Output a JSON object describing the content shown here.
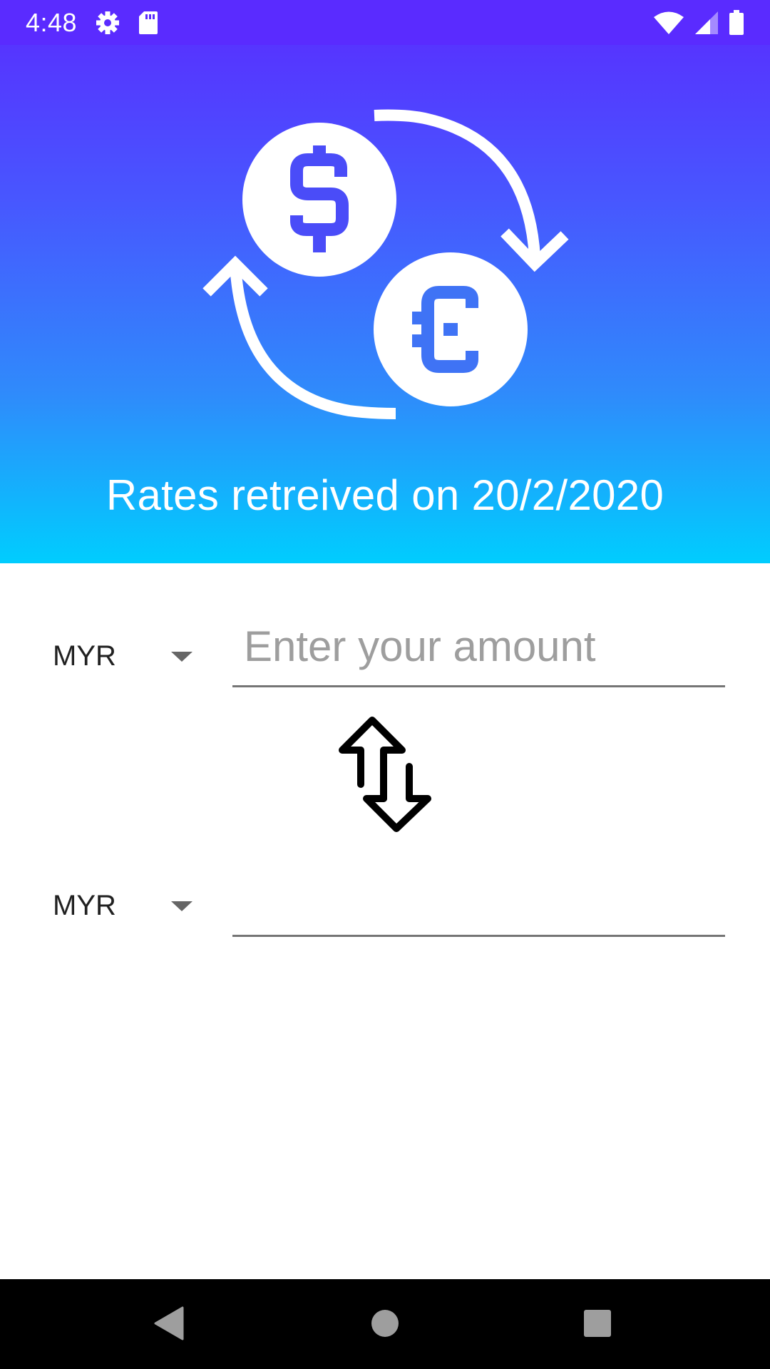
{
  "status_bar": {
    "time": "4:48",
    "icons": [
      "settings-icon",
      "sd-card-icon",
      "wifi-icon",
      "cell-signal-icon",
      "battery-icon"
    ]
  },
  "header": {
    "illustration": "currency-exchange-icon",
    "rates_text": "Rates retreived on 20/2/2020",
    "gradient": [
      "#5a2bff",
      "#00cdfe"
    ]
  },
  "converter": {
    "from_currency": "MYR",
    "amount_placeholder": "Enter your amount",
    "amount_value": "",
    "to_currency": "MYR",
    "result_value": "",
    "swap_icon": "swap-vertical-icon"
  },
  "nav_bar": {
    "buttons": [
      "back-icon",
      "home-icon",
      "recents-icon"
    ]
  }
}
